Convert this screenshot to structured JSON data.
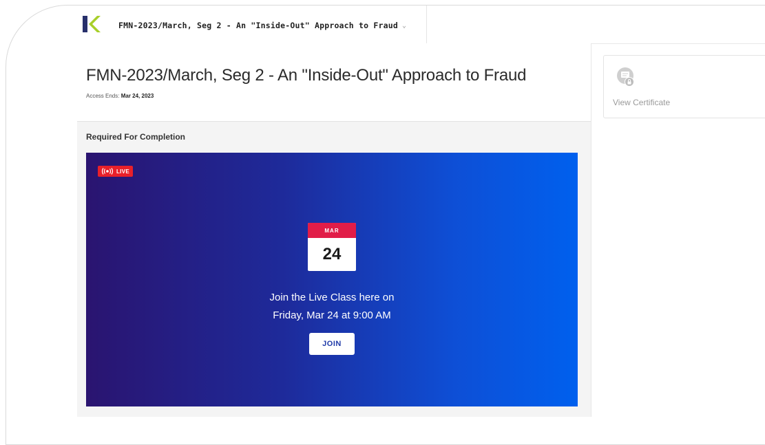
{
  "topbar": {
    "course_name": "FMN-2023/March, Seg 2 - An \"Inside-Out\" Approach to Fraud",
    "logo_icon": "k-logo-icon"
  },
  "header": {
    "title": "FMN-2023/March, Seg 2 - An \"Inside-Out\" Approach to Fraud",
    "access_label": "Access Ends:",
    "access_date": "Mar 24, 2023"
  },
  "section": {
    "label": "Required For Completion"
  },
  "live_class": {
    "badge": "LIVE",
    "badge_icon": "broadcast-icon",
    "calendar_month": "MAR",
    "calendar_day": "24",
    "line1": "Join the Live Class here on",
    "line2": "Friday, Mar 24 at 9:00 AM",
    "join_label": "JOIN",
    "colors": {
      "gradient_start": "#2a1470",
      "gradient_end": "#0060ee",
      "accent": "#e11d48"
    }
  },
  "sidebar": {
    "certificate_label": "View Certificate",
    "certificate_icon": "certificate-lock-icon"
  }
}
